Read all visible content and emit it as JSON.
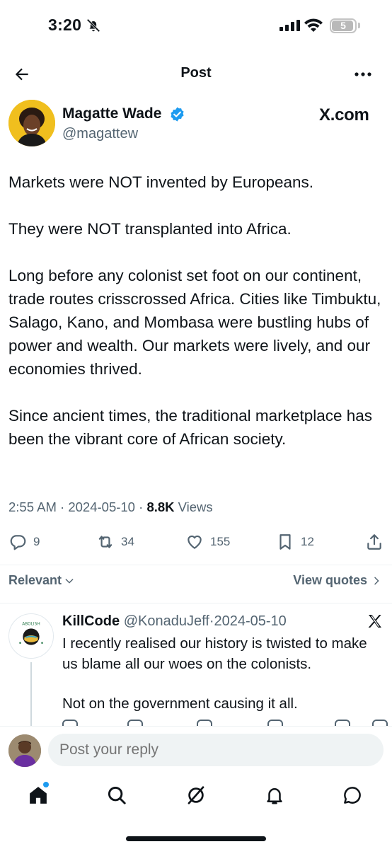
{
  "status_bar": {
    "time": "3:20",
    "battery": "5"
  },
  "nav": {
    "title": "Post"
  },
  "author": {
    "name": "Magatte Wade",
    "handle": "@magattew",
    "brand": "X.com"
  },
  "tweet": {
    "paragraphs": [
      "Markets were NOT invented by Europeans.",
      "They were NOT transplanted into Africa.",
      "Long before any colonist set foot on our continent, trade routes crisscrossed Africa. Cities like Timbuktu, Salago, Kano, and Mombasa were bustling hubs of power and wealth. Our markets were lively, and our economies thrived.",
      "Since ancient times, the traditional marketplace has been the vibrant core of African society."
    ],
    "time": "2:55 AM",
    "date": "2024-05-10",
    "views_count": "8.8K",
    "views_label": "Views"
  },
  "actions": {
    "replies": "9",
    "reposts": "34",
    "likes": "155",
    "bookmarks": "12"
  },
  "sort": {
    "relevant": "Relevant",
    "view_quotes": "View quotes"
  },
  "reply": {
    "name": "KillCode",
    "handle": "@KonaduJeff",
    "date": "2024-05-10",
    "avatar_text": "ABOLISH",
    "paragraphs": [
      "I recently realised our history is twisted to make us blame all our woes on the colonists.",
      "Not on the government causing it all."
    ]
  },
  "composer": {
    "placeholder": "Post your reply"
  },
  "colors": {
    "accent": "#1d9bf0",
    "text": "#0f1419",
    "secondary": "#536471",
    "avatar_bg": "#f0bf1e"
  }
}
